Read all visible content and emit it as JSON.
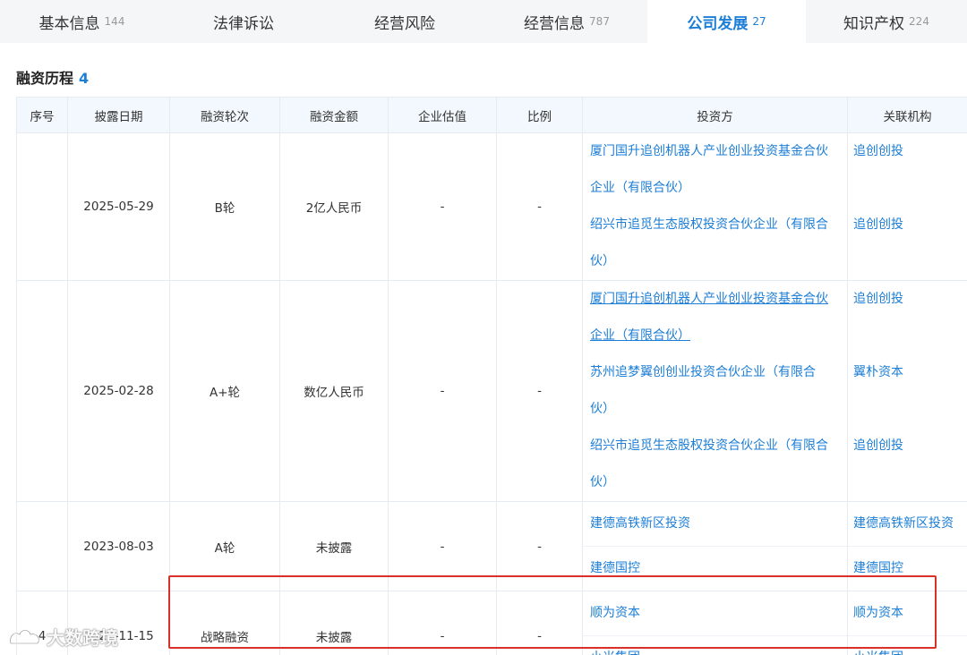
{
  "tabs": [
    {
      "label": "基本信息",
      "count": "144",
      "active": false
    },
    {
      "label": "法律诉讼",
      "count": "",
      "active": false
    },
    {
      "label": "经营风险",
      "count": "",
      "active": false
    },
    {
      "label": "经营信息",
      "count": "787",
      "active": false
    },
    {
      "label": "公司发展",
      "count": "27",
      "active": true
    },
    {
      "label": "知识产权",
      "count": "224",
      "active": false
    }
  ],
  "section": {
    "title": "融资历程",
    "count": "4"
  },
  "table": {
    "headers": [
      "序号",
      "披露日期",
      "融资轮次",
      "融资金额",
      "企业估值",
      "比例",
      "投资方",
      "关联机构"
    ],
    "rows": [
      {
        "index": "",
        "date": "2025-05-29",
        "round": "B轮",
        "amount": "2亿人民币",
        "valuation": "-",
        "ratio": "-",
        "investors": [
          {
            "name": "厦门国升追创机器人产业创业投资基金合伙企业（有限合伙）",
            "line1": "厦门国升追创机器人产业创业投资基金合伙",
            "line2": "企业（有限合伙）",
            "org": "追创创投"
          },
          {
            "name": "绍兴市追觅生态股权投资合伙企业（有限合伙）",
            "line1": "绍兴市追觅生态股权投资合伙企业（有限合",
            "line2": "伙）",
            "org": "追创创投"
          }
        ]
      },
      {
        "index": "",
        "date": "2025-02-28",
        "round": "A+轮",
        "amount": "数亿人民币",
        "valuation": "-",
        "ratio": "-",
        "investors": [
          {
            "name": "厦门国升追创机器人产业创业投资基金合伙企业（有限合伙）",
            "line1": "厦门国升追创机器人产业创业投资基金合伙",
            "line2": "企业（有限合伙）",
            "org": "追创创投"
          },
          {
            "name": "苏州追梦翼创创业投资合伙企业（有限合伙）",
            "line1": "苏州追梦翼创创业投资合伙企业（有限合",
            "line2": "伙）",
            "org": "翼朴资本"
          },
          {
            "name": "绍兴市追觅生态股权投资合伙企业（有限合伙）",
            "line1": "绍兴市追觅生态股权投资合伙企业（有限合",
            "line2": "伙）",
            "org": "追创创投"
          }
        ]
      },
      {
        "index": "",
        "date": "2023-08-03",
        "round": "A轮",
        "amount": "未披露",
        "valuation": "-",
        "ratio": "-",
        "investors": [
          {
            "name": "建德高铁新区投资",
            "org": "建德高铁新区投资"
          },
          {
            "name": "建德国控",
            "org": "建德国控"
          }
        ]
      },
      {
        "index": "4",
        "date": "2021-11-15",
        "round": "战略融资",
        "amount": "未披露",
        "valuation": "-",
        "ratio": "-",
        "investors": [
          {
            "name": "顺为资本",
            "org": "顺为资本"
          },
          {
            "name": "小米集团",
            "org": "小米集团"
          }
        ]
      }
    ]
  },
  "watermark": "大数跨境",
  "colors": {
    "accent": "#1c7ed6",
    "highlight": "#d9302a",
    "header_bg": "#f2f8fd"
  }
}
